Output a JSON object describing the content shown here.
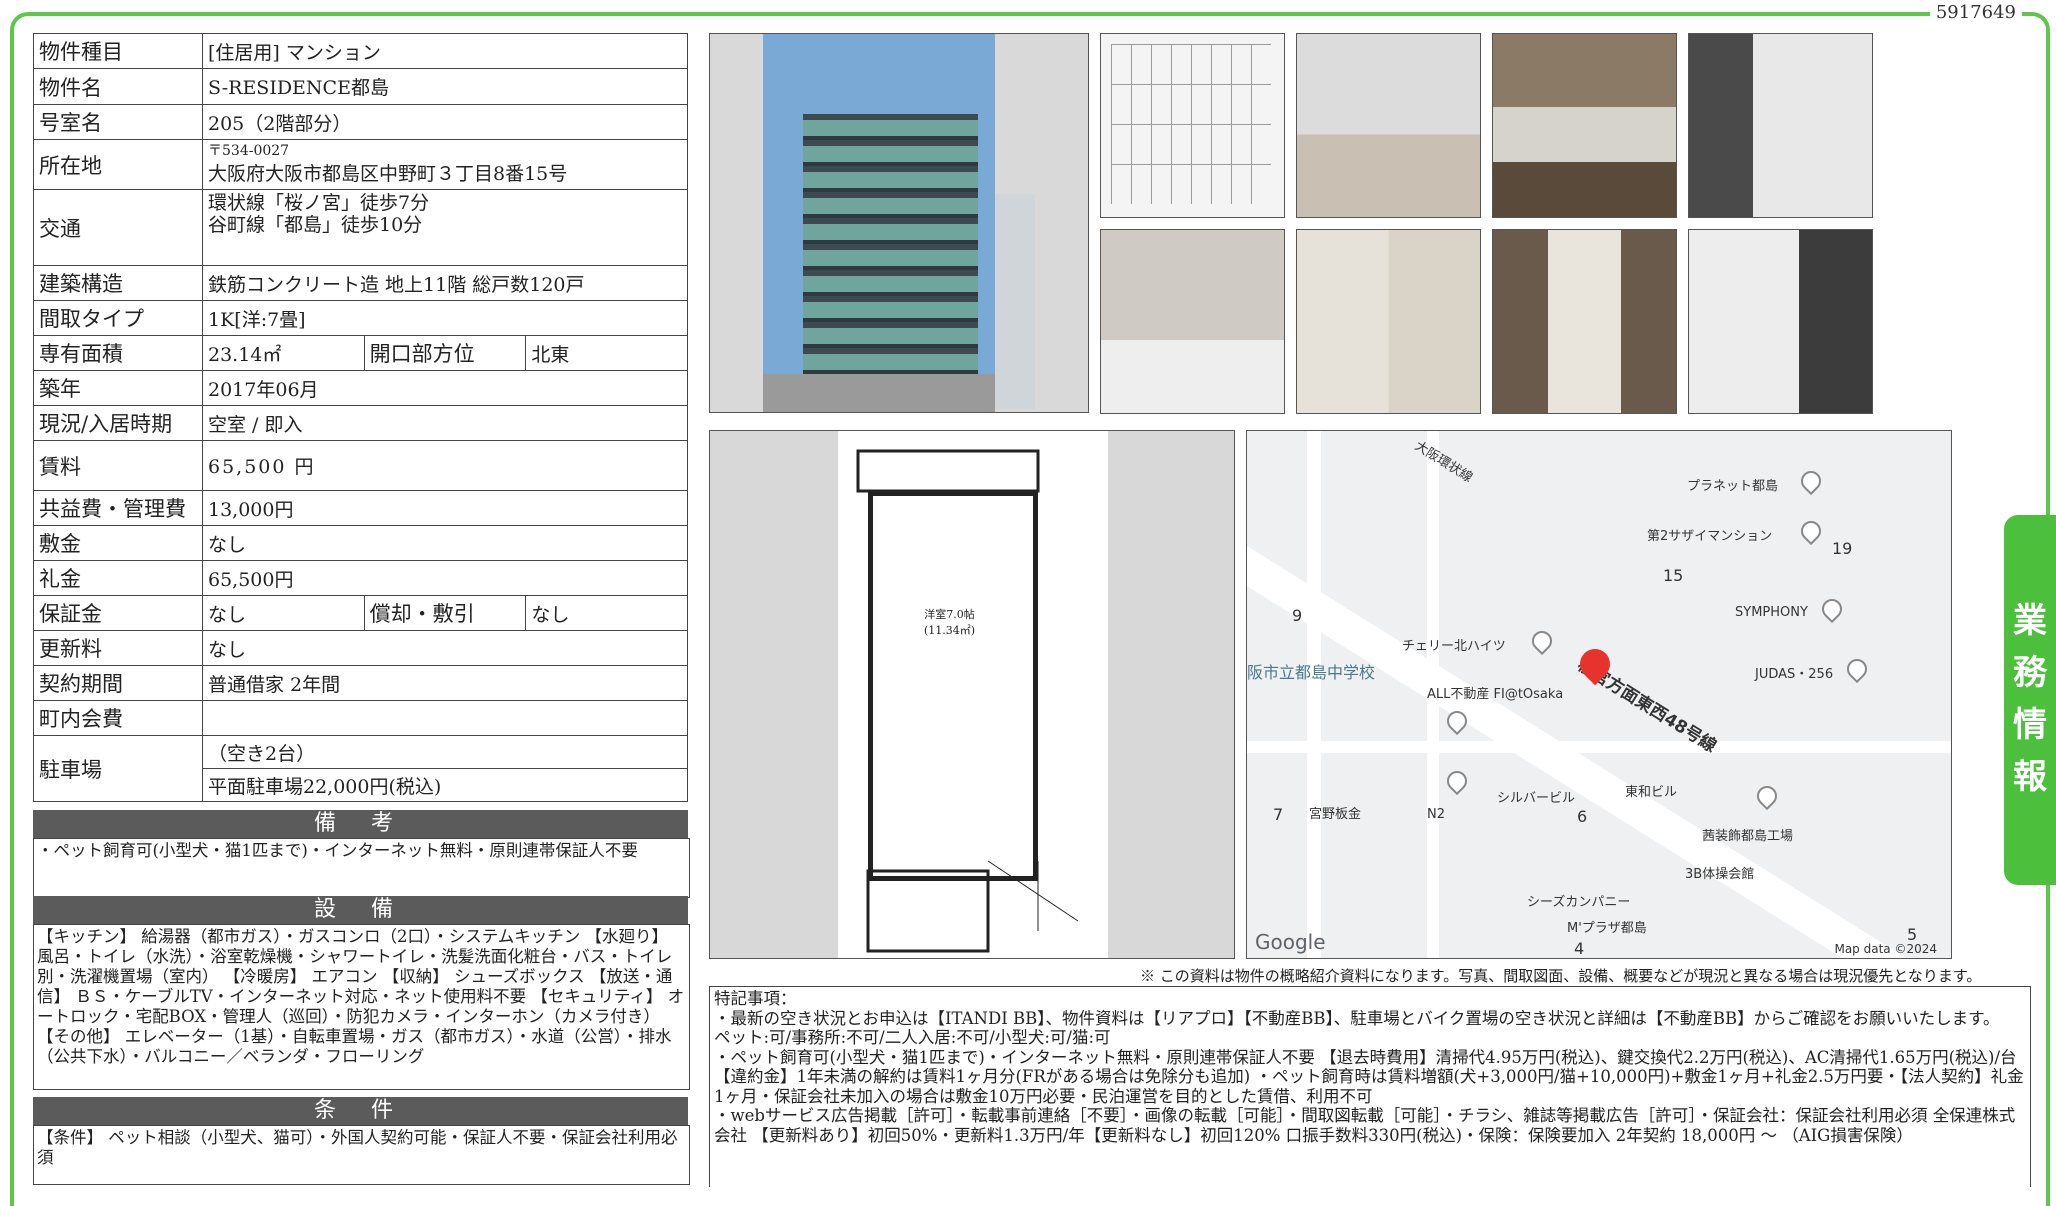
{
  "doc_id": "5917649",
  "tab_label": "業務情報",
  "spec": {
    "type_label": "物件種目",
    "type_value": "[住居用] マンション",
    "name_label": "物件名",
    "name_value": "S-RESIDENCE都島",
    "room_label": "号室名",
    "room_value": "205（2階部分）",
    "address_label": "所在地",
    "postal": "〒534-0027",
    "address": "大阪府大阪市都島区中野町３丁目8番15号",
    "access_label": "交通",
    "access_1": "環状線「桜ノ宮」徒歩7分",
    "access_2": "谷町線「都島」徒歩10分",
    "structure_label": "建築構造",
    "structure_value": "鉄筋コンクリート造 地上11階 総戸数120戸",
    "layout_label": "間取タイプ",
    "layout_value": "1K[洋:7畳]",
    "area_label": "専有面積",
    "area_value": "23.14㎡",
    "orientation_label": "開口部方位",
    "orientation_value": "北東",
    "built_label": "築年",
    "built_value": "2017年06月",
    "status_label": "現況/入居時期",
    "status_value": "空室 / 即入",
    "rent_label": "賃料",
    "rent_value": "65,500 円",
    "mgmt_label": "共益費・管理費",
    "mgmt_value": "13,000円",
    "deposit_label": "敷金",
    "deposit_value": "なし",
    "keymoney_label": "礼金",
    "keymoney_value": "65,500円",
    "guarantee_label": "保証金",
    "guarantee_value": "なし",
    "amort_label": "償却・敷引",
    "amort_value": "なし",
    "renewal_label": "更新料",
    "renewal_value": "なし",
    "contract_label": "契約期間",
    "contract_value": "普通借家 2年間",
    "assoc_label": "町内会費",
    "assoc_value": "",
    "parking_label": "駐車場",
    "parking_1": "（空き2台）",
    "parking_2": "平面駐車場22,000円(税込)"
  },
  "remarks": {
    "title": "備 考",
    "text": "・ペット飼育可(小型犬・猫1匹まで)・インターネット無料・原則連帯保証人不要"
  },
  "equipment": {
    "title": "設 備",
    "text": "【キッチン】 給湯器（都市ガス）・ガスコンロ（2口）・システムキッチン 【水廻り】 風呂・トイレ（水洗）・浴室乾燥機・シャワートイレ・洗髪洗面化粧台・バス・トイレ別・洗濯機置場（室内） 【冷暖房】 エアコン 【収納】 シューズボックス 【放送・通信】 ＢＳ・ケーブルTV・インターネット対応・ネット使用料不要 【セキュリティ】 オートロック・宅配BOX・管理人（巡回）・防犯カメラ・インターホン（カメラ付き） 【その他】 エレベーター（1基）・自転車置場・ガス（都市ガス）・水道（公営）・排水（公共下水）・バルコニー／ベランダ・フローリング"
  },
  "conditions": {
    "title": "条 件",
    "text": "【条件】 ペット相談（小型犬、猫可）・外国人契約可能・保証人不要・保証会社利用必須"
  },
  "map": {
    "labels": [
      "大阪環状線",
      "プラネット都島",
      "第2サザイマンション",
      "19",
      "15",
      "SYMPHONY",
      "9",
      "チェリー北ハイツ",
      "阪市立都島中学校",
      "ALL不動産 FI@tOsaka",
      "桜宮方面東西48号線",
      "JUDAS・256",
      "シルバービル",
      "東和ビル",
      "7",
      "宮野板金",
      "N2",
      "6",
      "茜装飾都島工場",
      "3B体操会館",
      "シーズカンパニー",
      "M'プラザ都島",
      "4",
      "5"
    ],
    "google": "Google",
    "data": "Map data ©2024"
  },
  "floorplan": {
    "room_label": "洋室7.0帖",
    "room_area": "(11.34㎡)"
  },
  "note": "※ この資料は物件の概略紹介資料になります。写真、間取図面、設備、概要などが現況と異なる場合は現況優先となります。",
  "special": {
    "lines": [
      "特記事項：",
      "・最新の空き状況とお申込は【ITANDI BB】、物件資料は【リアプロ】【不動産BB】、駐車場とバイク置場の空き状況と詳細は【不動産BB】からご確認をお願いいたします。",
      "ペット:可/事務所:不可/二人入居:不可/小型犬:可/猫:可",
      "・ペット飼育可(小型犬・猫1匹まで)・インターネット無料・原則連帯保証人不要 【退去時費用】清掃代4.95万円(税込)、鍵交換代2.2万円(税込)、AC清掃代1.65万円(税込)/台【違約金】1年未満の解約は賃料1ヶ月分(FRがある場合は免除分も追加) ・ペット飼育時は賃料増額(犬+3,000円/猫+10,000円)+敷金1ヶ月+礼金2.5万円要・【法人契約】礼金1ヶ月・保証会社未加入の場合は敷金10万円必要・民泊運営を目的とした賃借、利用不可",
      "・webサービス広告掲載［許可］・転載事前連絡［不要］・画像の転載［可能］・間取図転載［可能］・チラシ、雑誌等掲載広告［許可］・保証会社：保証会社利用必須 全保連株式会社 【更新料あり】初回50%・更新料1.3万円/年【更新料なし】初回120% 口振手数料330円(税込)・保険：保険要加入 2年契約 18,000円 ～ （AIG損害保険）"
    ]
  }
}
